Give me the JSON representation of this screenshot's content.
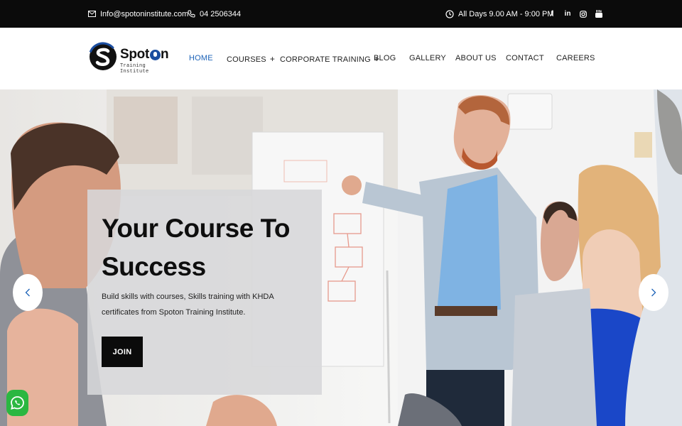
{
  "topbar": {
    "email": "Info@spotoninstitute.com",
    "phone": "04 2506344",
    "hours": "All Days 9.00 AM - 9:00 PM",
    "socials": [
      {
        "icon": "facebook-icon",
        "glyph": "f"
      },
      {
        "icon": "linkedin-icon",
        "glyph": "in"
      },
      {
        "icon": "instagram-icon",
        "glyph": ""
      },
      {
        "icon": "youtube-icon",
        "glyph": ""
      }
    ]
  },
  "logo": {
    "brand_prefix": "Spot",
    "brand_suffix": "n",
    "tagline": "Training Institute"
  },
  "nav": {
    "items": [
      {
        "label": "HOME",
        "active": true,
        "has_submenu": false
      },
      {
        "label": "COURSES",
        "active": false,
        "has_submenu": true
      },
      {
        "label": "CORPORATE TRAINING",
        "active": false,
        "has_submenu": true
      },
      {
        "label": "BLOG",
        "active": false,
        "has_submenu": false
      },
      {
        "label": "GALLERY",
        "active": false,
        "has_submenu": false
      },
      {
        "label": "ABOUT US",
        "active": false,
        "has_submenu": false
      },
      {
        "label": "CONTACT",
        "active": false,
        "has_submenu": false
      },
      {
        "label": "CAREERS",
        "active": false,
        "has_submenu": false
      }
    ],
    "submenu_symbol": "+"
  },
  "hero": {
    "title_line1": "Your Course To",
    "title_line2": "Success",
    "subtitle_line1": "Build skills with courses, Skills training with KHDA",
    "subtitle_line2": "certificates from Spoton Training Institute.",
    "button_label": "JOIN",
    "prev_icon": "chevron-left-icon",
    "next_icon": "chevron-right-icon"
  },
  "colors": {
    "topbar_bg": "#0b0b0b",
    "accent": "#1d63b8",
    "card_bg": "#d7d7d9",
    "button_bg": "#0b0b0b",
    "whatsapp": "#2bb741"
  }
}
